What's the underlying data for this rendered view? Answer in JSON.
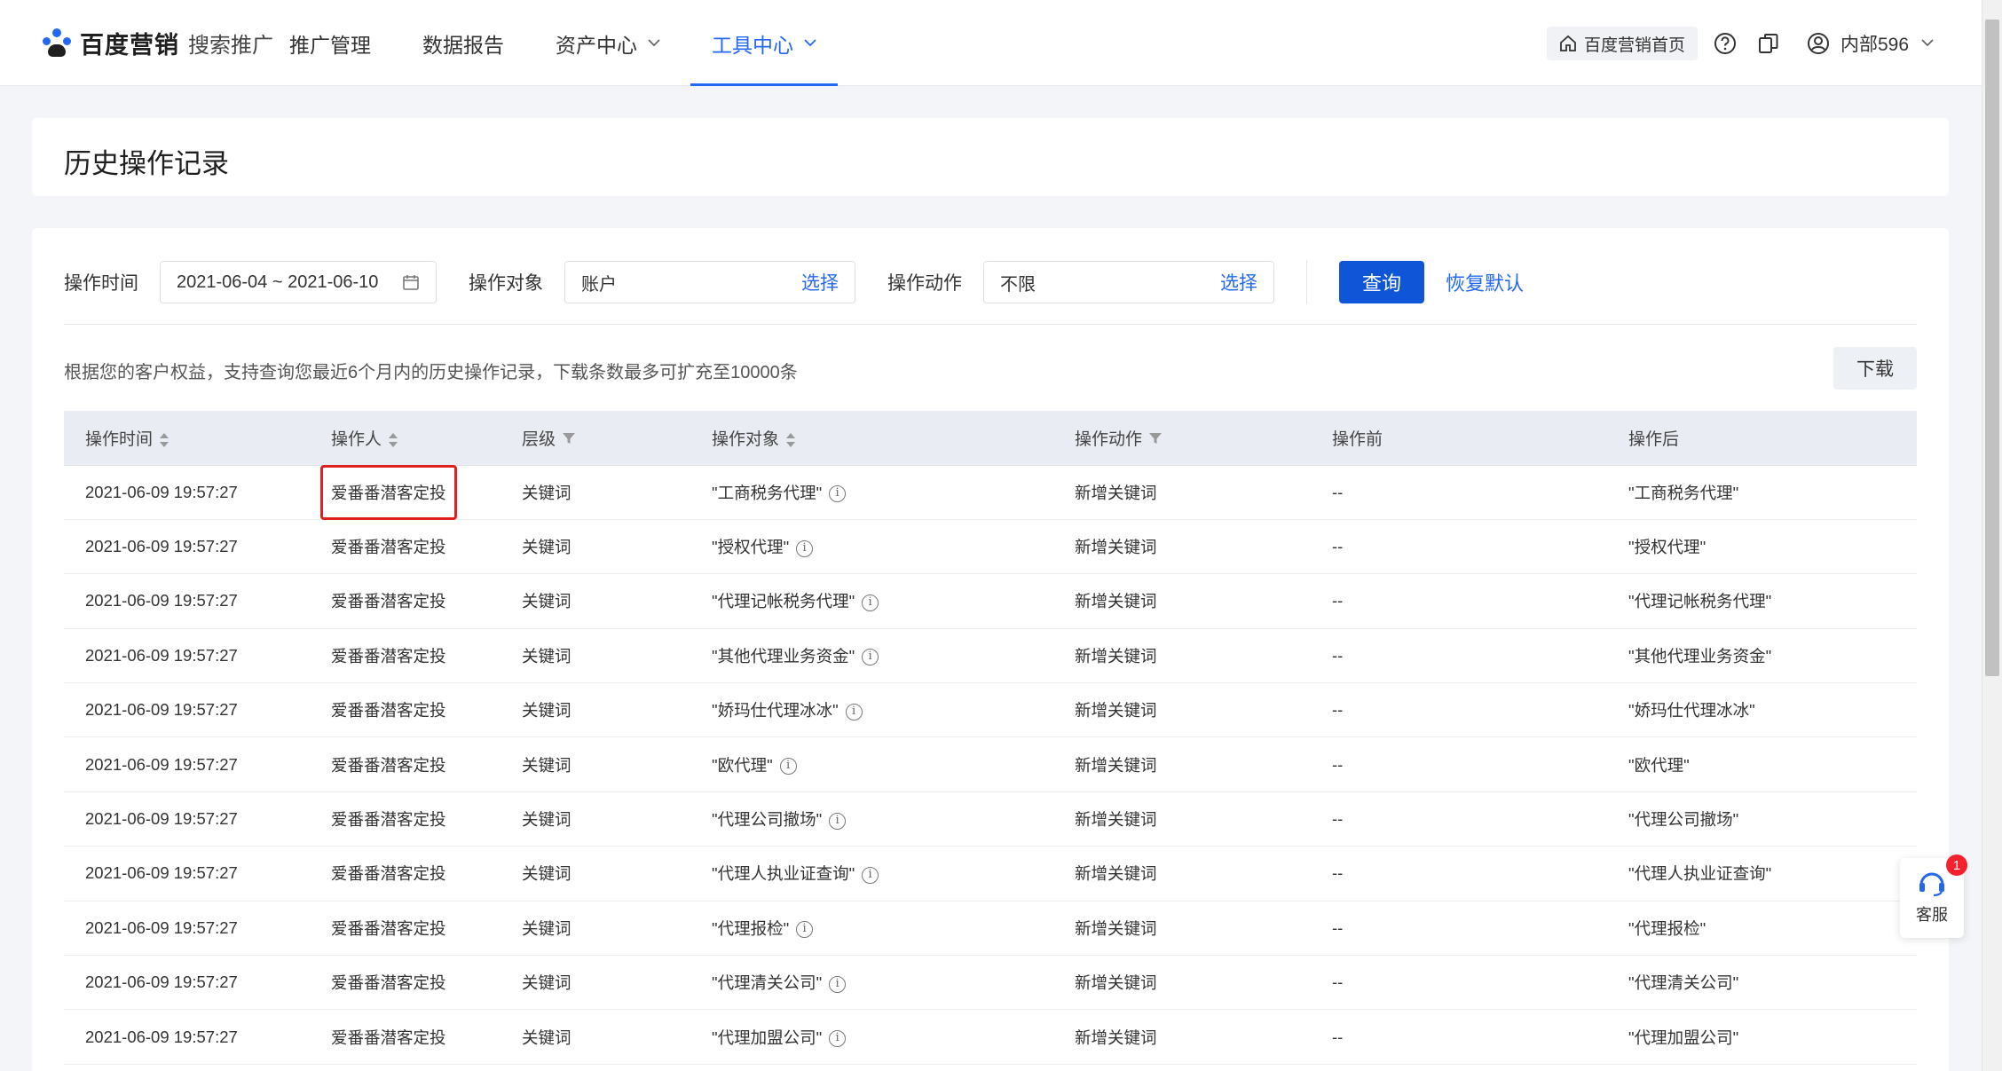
{
  "header": {
    "brand_name": "百度营销",
    "brand_sub": "搜索推广",
    "nav": [
      {
        "label": "推广管理"
      },
      {
        "label": "数据报告"
      },
      {
        "label": "资产中心"
      },
      {
        "label": "工具中心"
      }
    ],
    "home_label": "百度营销首页",
    "user_name": "内部596",
    "accent_color": "#2468f2"
  },
  "page_title": "历史操作记录",
  "filters": {
    "time_label": "操作时间",
    "time_value": "2021-06-04 ~ 2021-06-10",
    "object_label": "操作对象",
    "object_value": "账户",
    "object_select": "选择",
    "action_label": "操作动作",
    "action_value": "不限",
    "action_select": "选择",
    "query_label": "查询",
    "reset_label": "恢复默认"
  },
  "notice": "根据您的客户权益，支持查询您最近6个月内的历史操作记录，下载条数最多可扩充至10000条",
  "download_label": "下载",
  "table": {
    "headers": [
      "操作时间",
      "操作人",
      "层级",
      "操作对象",
      "操作动作",
      "操作前",
      "操作后"
    ],
    "rows": [
      [
        "2021-06-09 19:57:27",
        "爱番番潜客定投",
        "关键词",
        "\"工商税务代理\"",
        "新增关键词",
        "--",
        "\"工商税务代理\""
      ],
      [
        "2021-06-09 19:57:27",
        "爱番番潜客定投",
        "关键词",
        "\"授权代理\"",
        "新增关键词",
        "--",
        "\"授权代理\""
      ],
      [
        "2021-06-09 19:57:27",
        "爱番番潜客定投",
        "关键词",
        "\"代理记帐税务代理\"",
        "新增关键词",
        "--",
        "\"代理记帐税务代理\""
      ],
      [
        "2021-06-09 19:57:27",
        "爱番番潜客定投",
        "关键词",
        "\"其他代理业务资金\"",
        "新增关键词",
        "--",
        "\"其他代理业务资金\""
      ],
      [
        "2021-06-09 19:57:27",
        "爱番番潜客定投",
        "关键词",
        "\"娇玛仕代理冰冰\"",
        "新增关键词",
        "--",
        "\"娇玛仕代理冰冰\""
      ],
      [
        "2021-06-09 19:57:27",
        "爱番番潜客定投",
        "关键词",
        "\"欧代理\"",
        "新增关键词",
        "--",
        "\"欧代理\""
      ],
      [
        "2021-06-09 19:57:27",
        "爱番番潜客定投",
        "关键词",
        "\"代理公司撤场\"",
        "新增关键词",
        "--",
        "\"代理公司撤场\""
      ],
      [
        "2021-06-09 19:57:27",
        "爱番番潜客定投",
        "关键词",
        "\"代理人执业证查询\"",
        "新增关键词",
        "--",
        "\"代理人执业证查询\""
      ],
      [
        "2021-06-09 19:57:27",
        "爱番番潜客定投",
        "关键词",
        "\"代理报检\"",
        "新增关键词",
        "--",
        "\"代理报检\""
      ],
      [
        "2021-06-09 19:57:27",
        "爱番番潜客定投",
        "关键词",
        "\"代理清关公司\"",
        "新增关键词",
        "--",
        "\"代理清关公司\""
      ],
      [
        "2021-06-09 19:57:27",
        "爱番番潜客定投",
        "关键词",
        "\"代理加盟公司\"",
        "新增关键词",
        "--",
        "\"代理加盟公司\""
      ]
    ]
  },
  "customer_service": {
    "label": "客服",
    "badge": "1"
  },
  "highlight_color": "#e0201d"
}
